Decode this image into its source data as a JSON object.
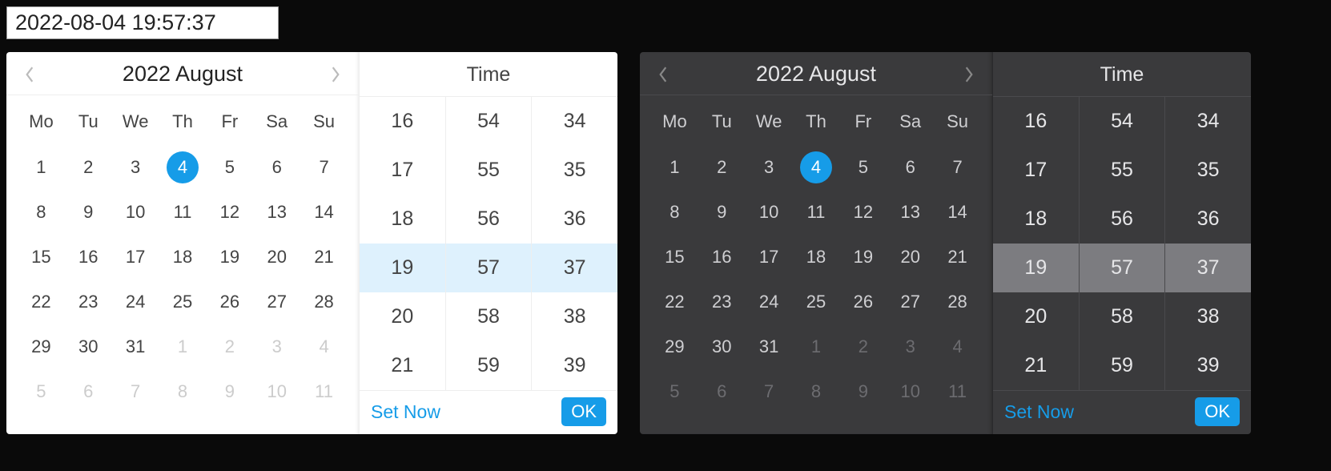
{
  "input_value": "2022-08-04 19:57:37",
  "year_month": "2022 August",
  "time_label": "Time",
  "set_now_label": "Set Now",
  "ok_label": "OK",
  "dow": [
    "Mo",
    "Tu",
    "We",
    "Th",
    "Fr",
    "Sa",
    "Su"
  ],
  "days": [
    {
      "n": "1"
    },
    {
      "n": "2"
    },
    {
      "n": "3"
    },
    {
      "n": "4",
      "sel": true
    },
    {
      "n": "5"
    },
    {
      "n": "6"
    },
    {
      "n": "7"
    },
    {
      "n": "8"
    },
    {
      "n": "9"
    },
    {
      "n": "10"
    },
    {
      "n": "11"
    },
    {
      "n": "12"
    },
    {
      "n": "13"
    },
    {
      "n": "14"
    },
    {
      "n": "15"
    },
    {
      "n": "16"
    },
    {
      "n": "17"
    },
    {
      "n": "18"
    },
    {
      "n": "19"
    },
    {
      "n": "20"
    },
    {
      "n": "21"
    },
    {
      "n": "22"
    },
    {
      "n": "23"
    },
    {
      "n": "24"
    },
    {
      "n": "25"
    },
    {
      "n": "26"
    },
    {
      "n": "27"
    },
    {
      "n": "28"
    },
    {
      "n": "29"
    },
    {
      "n": "30"
    },
    {
      "n": "31"
    },
    {
      "n": "1",
      "out": true
    },
    {
      "n": "2",
      "out": true
    },
    {
      "n": "3",
      "out": true
    },
    {
      "n": "4",
      "out": true
    },
    {
      "n": "5",
      "out": true
    },
    {
      "n": "6",
      "out": true
    },
    {
      "n": "7",
      "out": true
    },
    {
      "n": "8",
      "out": true
    },
    {
      "n": "9",
      "out": true
    },
    {
      "n": "10",
      "out": true
    },
    {
      "n": "11",
      "out": true
    }
  ],
  "hours": [
    "16",
    "17",
    "18",
    "19",
    "20",
    "21"
  ],
  "minutes": [
    "54",
    "55",
    "56",
    "57",
    "58",
    "59"
  ],
  "seconds": [
    "34",
    "35",
    "36",
    "37",
    "38",
    "39"
  ],
  "selected_index": 3
}
